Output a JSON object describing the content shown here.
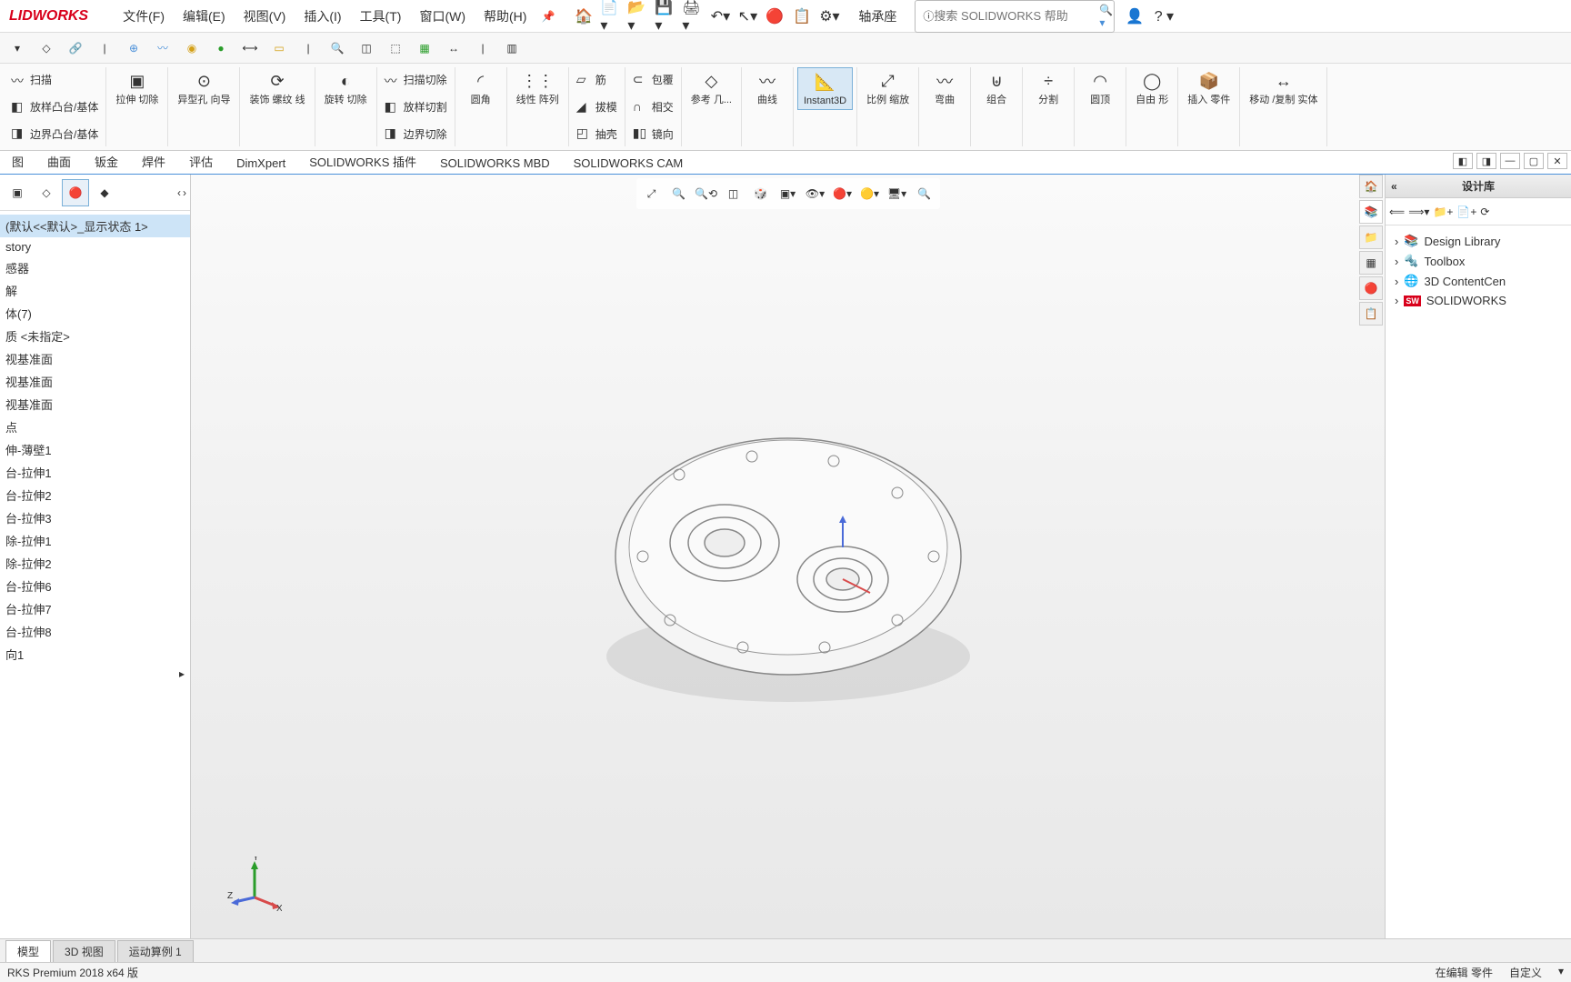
{
  "app": {
    "logo": "LIDWORKS"
  },
  "menu": {
    "file": "文件(F)",
    "edit": "编辑(E)",
    "view": "视图(V)",
    "insert": "插入(I)",
    "tools": "工具(T)",
    "window": "窗口(W)",
    "help": "帮助(H)"
  },
  "doc_name": "轴承座",
  "search": {
    "placeholder": "搜索 SOLIDWORKS 帮助"
  },
  "ribbon": {
    "sweep": "扫描",
    "loft": "放样凸台/基体",
    "boundary": "边界凸台/基体",
    "extrude_cut": "拉伸\n切除",
    "hole_wizard": "异型孔\n向导",
    "thread": "装饰\n螺纹\n线",
    "revolve_cut": "旋转\n切除",
    "sweep_cut": "扫描切除",
    "loft_cut": "放样切割",
    "boundary_cut": "边界切除",
    "fillet": "圆角",
    "linear_pattern": "线性\n阵列",
    "rib": "筋",
    "draft": "拔模",
    "shell": "抽壳",
    "wrap": "包覆",
    "intersect": "相交",
    "mirror": "镜向",
    "ref_geom": "参考\n几...",
    "curves": "曲线",
    "instant3d": "Instant3D",
    "scale": "比例\n缩放",
    "flex": "弯曲",
    "combine": "组合",
    "split": "分割",
    "dome": "圆顶",
    "freeform": "自由\n形",
    "insert_part": "插入\n零件",
    "move_copy": "移动\n/复制\n实体"
  },
  "cmd_tabs": {
    "surface": "曲面",
    "sheetmetal": "钣金",
    "weldment": "焊件",
    "evaluate": "评估",
    "dimxpert": "DimXpert",
    "addins": "SOLIDWORKS 插件",
    "mbd": "SOLIDWORKS MBD",
    "cam": "SOLIDWORKS CAM"
  },
  "feature_tree": {
    "root": "(默认<<默认>_显示状态 1>",
    "items": [
      "story",
      "感器",
      "解",
      "体(7)",
      "质 <未指定>",
      "视基准面",
      "视基准面",
      "视基准面",
      "点",
      "伸-薄壁1",
      "台-拉伸1",
      "台-拉伸2",
      "台-拉伸3",
      "除-拉伸1",
      "除-拉伸2",
      "台-拉伸6",
      "台-拉伸7",
      "台-拉伸8",
      "向1"
    ]
  },
  "design_library": {
    "title": "设计库",
    "items": [
      "Design Library",
      "Toolbox",
      "3D ContentCen",
      "SOLIDWORKS"
    ]
  },
  "bottom_tabs": {
    "model": "模型",
    "view3d": "3D 视图",
    "motion": "运动算例 1"
  },
  "statusbar": {
    "left": "RKS Premium 2018 x64 版",
    "editing": "在编辑 零件",
    "custom": "自定义"
  },
  "axis": {
    "x": "X",
    "y": "Y",
    "z": "Z"
  }
}
